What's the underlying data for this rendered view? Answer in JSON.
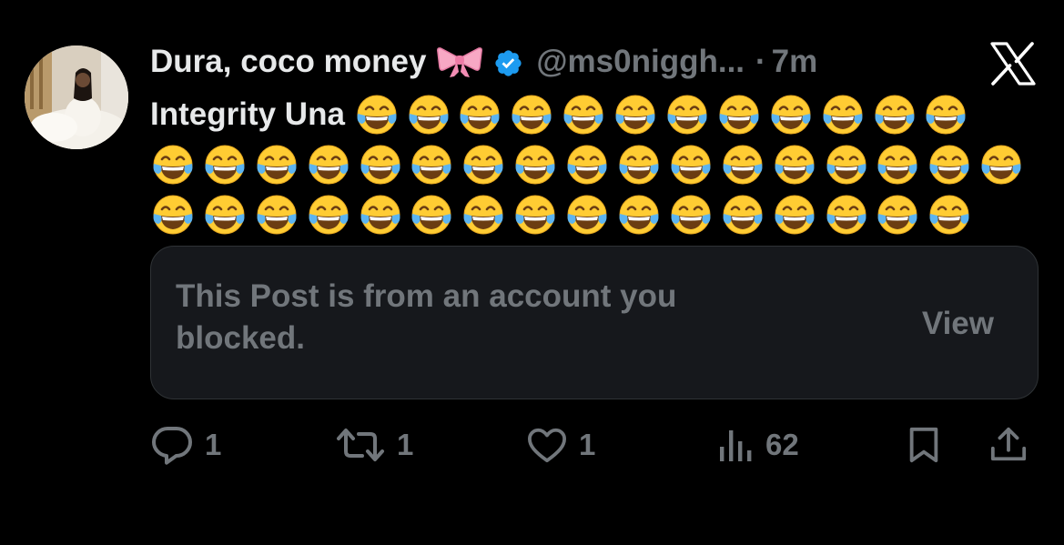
{
  "author": {
    "display_name": "Dura, coco money",
    "handle": "@ms0niggh...",
    "separator": "·",
    "time": "7m",
    "verified": true,
    "name_emoji": "ribbon",
    "verified_color": "#1d9bf0"
  },
  "post": {
    "lead_text": "Integrity Una",
    "emoji": "face-with-tears-of-joy",
    "emoji_rows": [
      12,
      17,
      16
    ]
  },
  "blocked_notice": {
    "message": "This Post is from an account you blocked.",
    "action_label": "View"
  },
  "actions": {
    "reply_count": "1",
    "repost_count": "1",
    "like_count": "1",
    "views_count": "62"
  },
  "colors": {
    "background": "#000000",
    "primary_text": "#e7e9ea",
    "secondary_text": "#71767b",
    "card_background": "#16181c",
    "card_border": "#2f3336",
    "accent": "#1d9bf0"
  },
  "icons": [
    "x-logo-icon",
    "verified-badge-icon",
    "ribbon-icon",
    "reply-icon",
    "repost-icon",
    "like-icon",
    "views-icon",
    "bookmark-icon",
    "share-icon"
  ]
}
